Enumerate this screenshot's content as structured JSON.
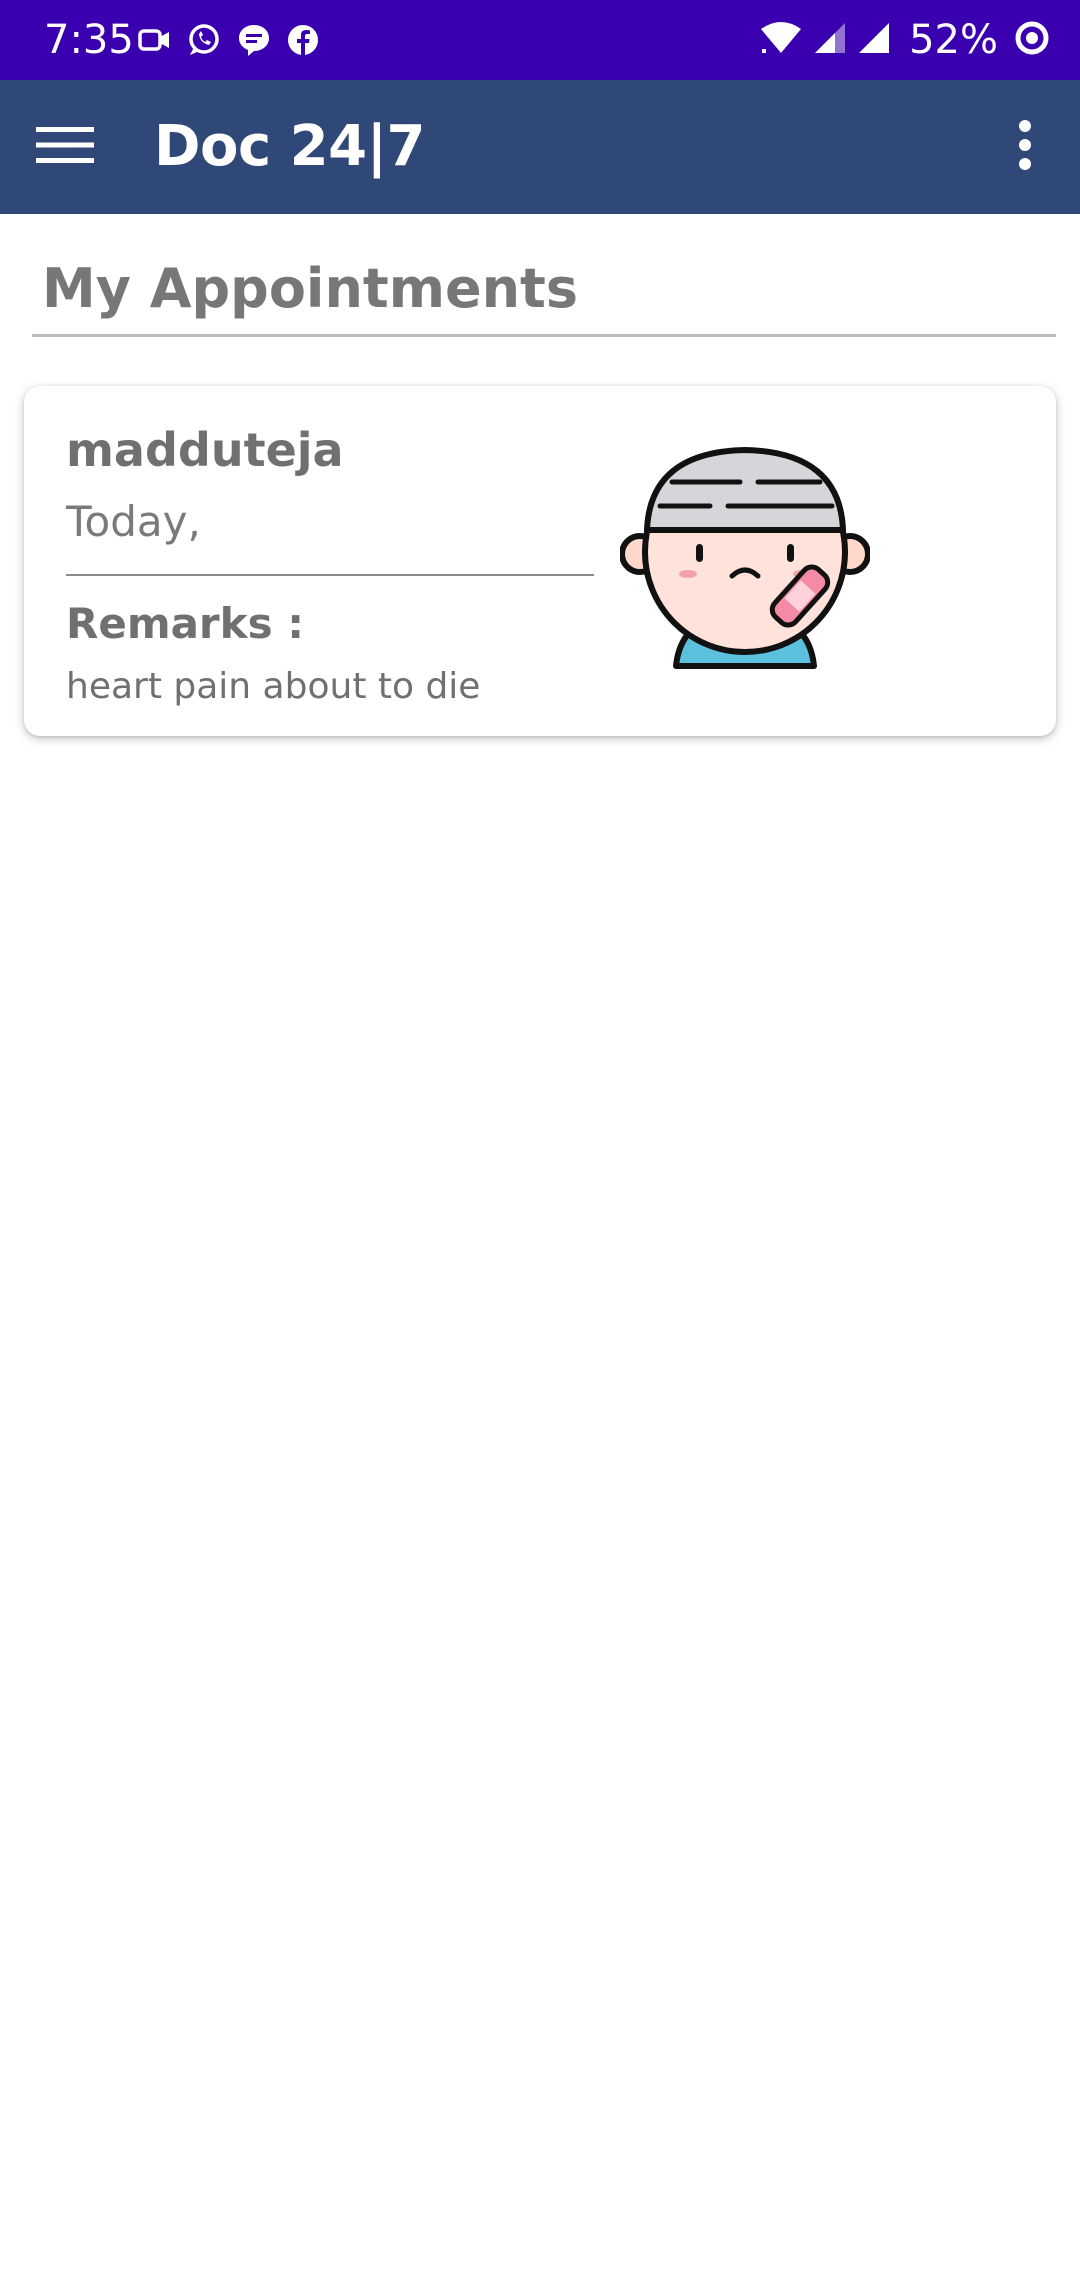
{
  "status_bar": {
    "time": "7:35",
    "battery": "52%",
    "notification_icons": [
      "video-camera-icon",
      "whatsapp-icon",
      "messenger-icon",
      "facebook-icon"
    ],
    "system_icons": [
      "wifi-icon",
      "cell-signal-icon",
      "cell-signal-icon",
      "battery-saver-icon"
    ],
    "background_color": "#3a00b0"
  },
  "app_bar": {
    "title": "Doc 24|7",
    "menu_icon": "hamburger-menu-icon",
    "overflow_icon": "more-vertical-icon",
    "background_color": "#2f4878"
  },
  "section": {
    "title": "My Appointments"
  },
  "appointments": [
    {
      "patient_name": "madduteja",
      "date": "Today,",
      "remarks_label": "Remarks :",
      "remarks": "heart pain about to die",
      "avatar_icon": "sick-patient-avatar-icon"
    }
  ]
}
